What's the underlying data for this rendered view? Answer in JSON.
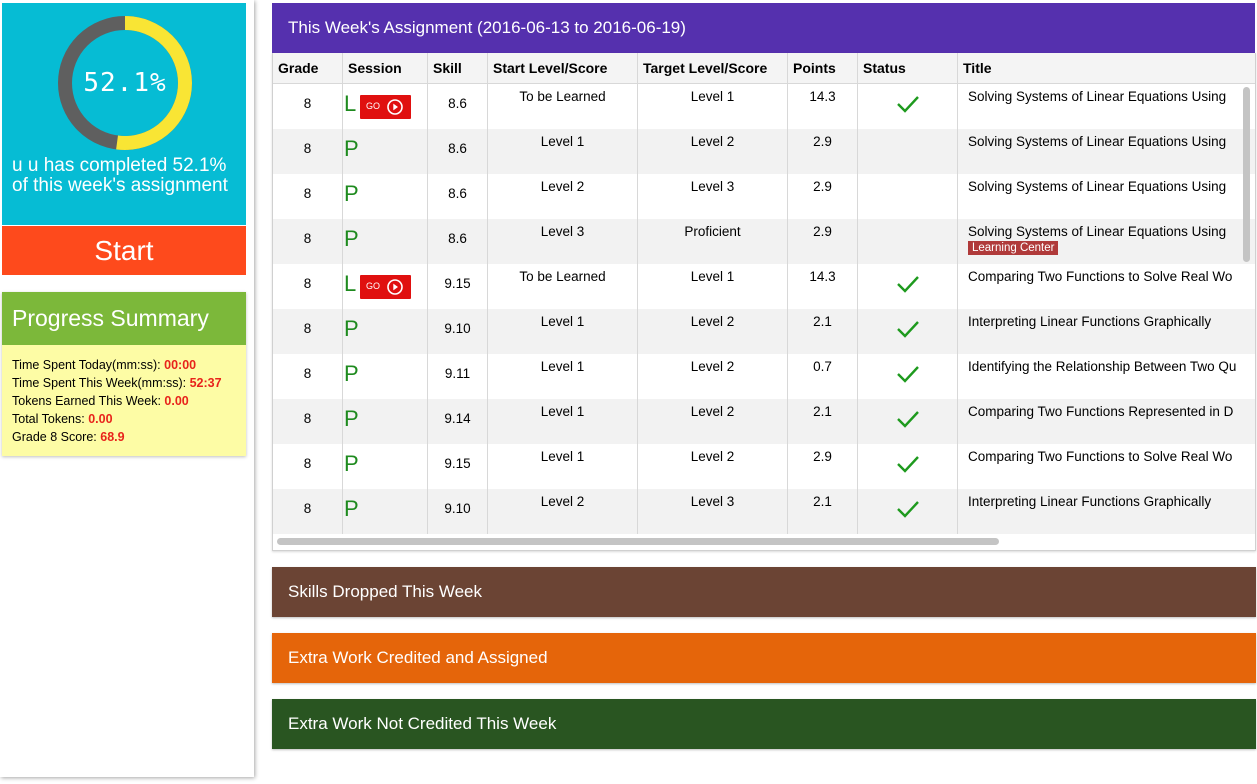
{
  "sidebar": {
    "progress_percent": 52.1,
    "progress_label": "52.1%",
    "completed_text": "u u has completed 52.1% of this week's assignment",
    "start_label": "Start",
    "summary_title": "Progress Summary",
    "summary": [
      {
        "label": "Time Spent Today(mm:ss): ",
        "value": "00:00"
      },
      {
        "label": "Time Spent This Week(mm:ss): ",
        "value": "52:37"
      },
      {
        "label": "Tokens Earned This Week: ",
        "value": "0.00"
      },
      {
        "label": "Total Tokens: ",
        "value": "0.00"
      },
      {
        "label": "Grade 8 Score: ",
        "value": "68.9"
      }
    ]
  },
  "assignment": {
    "title": "This Week's Assignment (2016-06-13 to 2016-06-19)",
    "columns": [
      "Grade",
      "Session",
      "Skill",
      "Start Level/Score",
      "Target Level/Score",
      "Points",
      "Status",
      "Title"
    ],
    "go_label": "GO",
    "rows": [
      {
        "grade": "8",
        "session": "L",
        "go": true,
        "skill": "8.6",
        "start": "To be Learned",
        "target": "Level 1",
        "points": "14.3",
        "status": "check",
        "title": "Solving Systems of Linear Equations Using",
        "badge": ""
      },
      {
        "grade": "8",
        "session": "P",
        "go": false,
        "skill": "8.6",
        "start": "Level 1",
        "target": "Level 2",
        "points": "2.9",
        "status": "",
        "title": "Solving Systems of Linear Equations Using",
        "badge": ""
      },
      {
        "grade": "8",
        "session": "P",
        "go": false,
        "skill": "8.6",
        "start": "Level 2",
        "target": "Level 3",
        "points": "2.9",
        "status": "",
        "title": "Solving Systems of Linear Equations Using",
        "badge": ""
      },
      {
        "grade": "8",
        "session": "P",
        "go": false,
        "skill": "8.6",
        "start": "Level 3",
        "target": "Proficient",
        "points": "2.9",
        "status": "",
        "title": "Solving Systems of Linear Equations Using",
        "badge": "Learning Center"
      },
      {
        "grade": "8",
        "session": "L",
        "go": true,
        "skill": "9.15",
        "start": "To be Learned",
        "target": "Level 1",
        "points": "14.3",
        "status": "check",
        "title": "Comparing Two Functions to Solve Real Wo",
        "badge": ""
      },
      {
        "grade": "8",
        "session": "P",
        "go": false,
        "skill": "9.10",
        "start": "Level 1",
        "target": "Level 2",
        "points": "2.1",
        "status": "check",
        "title": "Interpreting Linear Functions Graphically",
        "badge": ""
      },
      {
        "grade": "8",
        "session": "P",
        "go": false,
        "skill": "9.11",
        "start": "Level 1",
        "target": "Level 2",
        "points": "0.7",
        "status": "check",
        "title": "Identifying the Relationship Between Two Qu",
        "badge": ""
      },
      {
        "grade": "8",
        "session": "P",
        "go": false,
        "skill": "9.14",
        "start": "Level 1",
        "target": "Level 2",
        "points": "2.1",
        "status": "check",
        "title": "Comparing Two Functions Represented in D",
        "badge": ""
      },
      {
        "grade": "8",
        "session": "P",
        "go": false,
        "skill": "9.15",
        "start": "Level 1",
        "target": "Level 2",
        "points": "2.9",
        "status": "check",
        "title": "Comparing Two Functions to Solve Real Wo",
        "badge": ""
      },
      {
        "grade": "8",
        "session": "P",
        "go": false,
        "skill": "9.10",
        "start": "Level 2",
        "target": "Level 3",
        "points": "2.1",
        "status": "check",
        "title": "Interpreting Linear Functions Graphically",
        "badge": ""
      }
    ]
  },
  "sections": [
    {
      "label": "Skills Dropped This Week",
      "color": "#6b4434"
    },
    {
      "label": "Extra Work Credited and Assigned",
      "color": "#e5650a"
    },
    {
      "label": "Extra Work Not Credited This Week",
      "color": "#295521"
    }
  ],
  "colors": {
    "progress_bg": "#06bcd4",
    "ring_done": "#f9e534",
    "ring_remaining": "#5f5f5f",
    "start_bg": "#fe4a1c",
    "summary_header": "#7cb83a",
    "summary_body": "#fdfca5",
    "assignment_header": "#5530ae",
    "check": "#1e9a1e",
    "go_bg": "#e0100f"
  }
}
